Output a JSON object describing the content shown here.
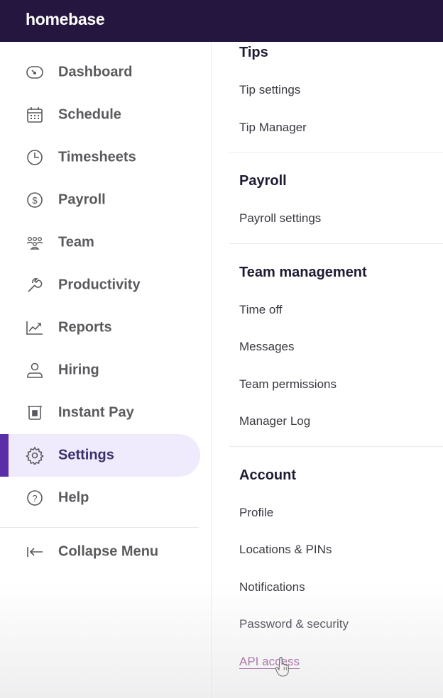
{
  "app": {
    "logo_text": "homebase"
  },
  "sidebar": {
    "items": [
      {
        "label": "Dashboard",
        "icon": "gauge-icon"
      },
      {
        "label": "Schedule",
        "icon": "calendar-icon"
      },
      {
        "label": "Timesheets",
        "icon": "clock-icon"
      },
      {
        "label": "Payroll",
        "icon": "dollar-icon"
      },
      {
        "label": "Team",
        "icon": "team-icon"
      },
      {
        "label": "Productivity",
        "icon": "wrench-icon"
      },
      {
        "label": "Reports",
        "icon": "chart-icon"
      },
      {
        "label": "Hiring",
        "icon": "person-icon"
      },
      {
        "label": "Instant Pay",
        "icon": "wallet-icon"
      },
      {
        "label": "Settings",
        "icon": "gear-icon",
        "active": true
      },
      {
        "label": "Help",
        "icon": "help-icon"
      }
    ],
    "collapse_label": "Collapse Menu"
  },
  "settings": {
    "sections": [
      {
        "title": "Tips",
        "links": [
          "Tip settings",
          "Tip Manager"
        ]
      },
      {
        "title": "Payroll",
        "links": [
          "Payroll settings"
        ]
      },
      {
        "title": "Team management",
        "links": [
          "Time off",
          "Messages",
          "Team permissions",
          "Manager Log"
        ]
      },
      {
        "title": "Account",
        "links": [
          "Profile",
          "Locations & PINs",
          "Notifications",
          "Password & security",
          "API access"
        ]
      }
    ]
  },
  "colors": {
    "topbar": "#24163f",
    "active_bg": "#efeafc",
    "active_bar": "#5b2ea8",
    "hover_link": "#8b3a82"
  }
}
